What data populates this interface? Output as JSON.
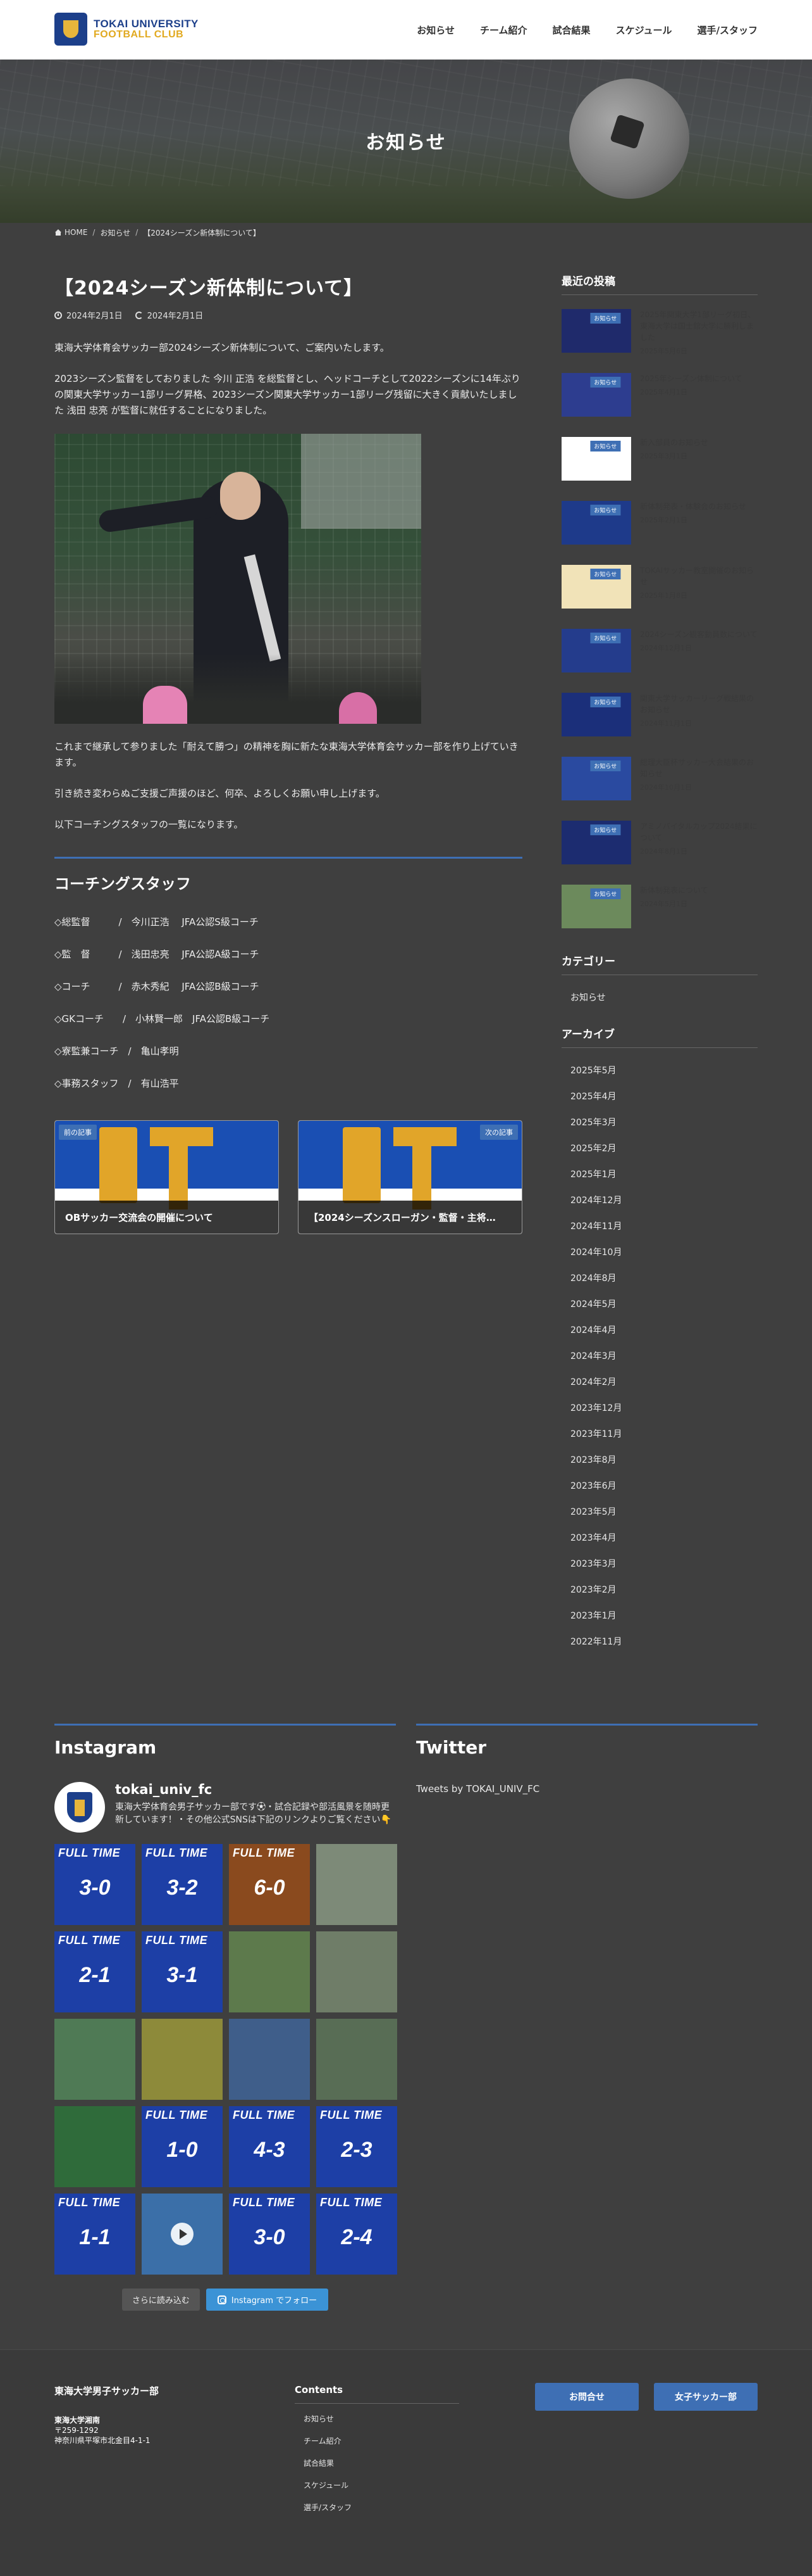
{
  "header": {
    "logo_line1": "TOKAI UNIVERSITY",
    "logo_line2": "FOOTBALL CLUB",
    "nav": [
      "お知らせ",
      "チーム紹介",
      "試合結果",
      "スケジュール",
      "選手/スタッフ"
    ]
  },
  "hero": {
    "title": "お知らせ"
  },
  "breadcrumb": [
    "HOME",
    "お知らせ",
    "【2024シーズン新体制について】"
  ],
  "post": {
    "title": "【2024シーズン新体制について】",
    "published": "2024年2月1日",
    "updated": "2024年2月1日",
    "intro": "東海大学体育会サッカー部2024シーズン新体制について、ご案内いたします。",
    "body1": "2023シーズン監督をしておりました 今川 正浩 を総監督とし、ヘッドコーチとして2022シーズンに14年ぶりの関東大学サッカー1部リーグ昇格、2023シーズン関東大学サッカー1部リーグ残留に大きく貢献いたしました 浅田 忠亮 が監督に就任することになりました。",
    "body2": "これまで継承して参りました「耐えて勝つ」の精神を胸に新たな東海大学体育会サッカー部を作り上げていきます。",
    "body3": "引き続き変わらぬご支援ご声援のほど、何卒、よろしくお願い申し上げます。",
    "body4": "以下コーチングスタッフの一覧になります。",
    "staff_heading": "コーチングスタッフ",
    "staff": [
      "◇総監督　　　/　今川正浩　 JFA公認S級コーチ",
      "◇監　督　　　/　浅田忠亮　 JFA公認A級コーチ",
      "◇コーチ　　　/　赤木秀紀　 JFA公認B級コーチ",
      "◇GKコーチ　　/　小林賢一郎　JFA公認B級コーチ",
      "◇寮監兼コーチ　/　亀山孝明",
      "◇事務スタッフ　/　有山浩平"
    ],
    "prev_tag": "前の記事",
    "prev_title": "OBサッカー交流会の開催について",
    "next_tag": "次の記事",
    "next_title": "【2024シーズンスローガン・監督・主将…"
  },
  "sidebar": {
    "recent_heading": "最近の投稿",
    "recent": [
      {
        "title": "2025年関東大学1部リーグ初日、東海大学は国士舘大学に勝利しました",
        "date": "2025年5月6日"
      },
      {
        "title": "2025年シーズン体制について",
        "date": "2025年4月1日"
      },
      {
        "title": "新入部員のお知らせ",
        "date": "2025年3月1日"
      },
      {
        "title": "新体制発表・体験会のお知らせ",
        "date": "2025年2月1日"
      },
      {
        "title": "TOKAIサッカー教室開催のお知らせ",
        "date": "2025年1月8日"
      },
      {
        "title": "2024シーズン観客動員数について",
        "date": "2024年12月1日"
      },
      {
        "title": "関東大学サッカーリーグ戦結果のお知らせ",
        "date": "2024年11月1日"
      },
      {
        "title": "総理大臣杯サッカー大会結果のお知らせ",
        "date": "2024年10月1日"
      },
      {
        "title": "アミノバイタルカップ2024結果について",
        "date": "2024年8月1日"
      },
      {
        "title": "新体制発表について",
        "date": "2024年5月1日"
      }
    ],
    "category_heading": "カテゴリー",
    "categories": [
      "お知らせ"
    ],
    "archive_heading": "アーカイブ",
    "archives": [
      "2025年5月",
      "2025年4月",
      "2025年3月",
      "2025年2月",
      "2025年1月",
      "2024年12月",
      "2024年11月",
      "2024年10月",
      "2024年8月",
      "2024年5月",
      "2024年4月",
      "2024年3月",
      "2024年2月",
      "2023年12月",
      "2023年11月",
      "2023年8月",
      "2023年6月",
      "2023年5月",
      "2023年4月",
      "2023年3月",
      "2023年2月",
      "2023年1月",
      "2022年11月"
    ]
  },
  "instagram": {
    "heading": "Instagram",
    "username": "tokai_univ_fc",
    "bio": "東海大学体育会男子サッカー部です⚽︎・試合記録や部活風景を随時更新しています！・その他公式SNSは下記のリンクよりご覧ください👇",
    "tiles": [
      {
        "type": "ft",
        "score": "3-0",
        "color": "#1d3fa6"
      },
      {
        "type": "ft",
        "score": "3-2",
        "color": "#1d3fa6"
      },
      {
        "type": "ft",
        "score": "6-0",
        "color": "#8a4a1e"
      },
      {
        "type": "photo",
        "color": "#7d8a78"
      },
      {
        "type": "ft",
        "score": "2-1",
        "color": "#1d3fa6"
      },
      {
        "type": "ft",
        "score": "3-1",
        "color": "#1d3fa6"
      },
      {
        "type": "photo",
        "color": "#5d7a4c"
      },
      {
        "type": "photo",
        "color": "#6f7d68"
      },
      {
        "type": "photo",
        "color": "#4f7a55"
      },
      {
        "type": "photo",
        "color": "#8d8a3a"
      },
      {
        "type": "photo",
        "color": "#3f5e8a"
      },
      {
        "type": "photo",
        "color": "#586d55"
      },
      {
        "type": "photo",
        "color": "#2f6b3a"
      },
      {
        "type": "ft",
        "score": "1-0",
        "color": "#1d3fa6"
      },
      {
        "type": "ft",
        "score": "4-3",
        "color": "#1d3fa6"
      },
      {
        "type": "ft",
        "score": "2-3",
        "color": "#1d3fa6"
      },
      {
        "type": "ft",
        "score": "1-1",
        "color": "#1d3fa6"
      },
      {
        "type": "video",
        "color": "#3b6fa8"
      },
      {
        "type": "ft",
        "score": "3-0",
        "color": "#1d3fa6"
      },
      {
        "type": "ft",
        "score": "2-4",
        "color": "#1d3fa6"
      }
    ],
    "tile_label": "FULL TIME",
    "more": "さらに読み込む",
    "follow": "Instagram でフォロー"
  },
  "twitter": {
    "heading": "Twitter",
    "link": "Tweets by TOKAI_UNIV_FC"
  },
  "footer": {
    "title": "東海大学男子サッカー部",
    "addr1": "東海大学湘南",
    "addr2": "〒259-1292",
    "addr3": "神奈川県平塚市北金目4-1-1",
    "contents_heading": "Contents",
    "links": [
      "お知らせ",
      "チーム紹介",
      "試合結果",
      "スケジュール",
      "選手/スタッフ"
    ],
    "btn_contact": "お問合せ",
    "btn_women": "女子サッカー部"
  },
  "colors": {
    "accent": "#3e6fb4",
    "bg": "#3f3f3f"
  }
}
